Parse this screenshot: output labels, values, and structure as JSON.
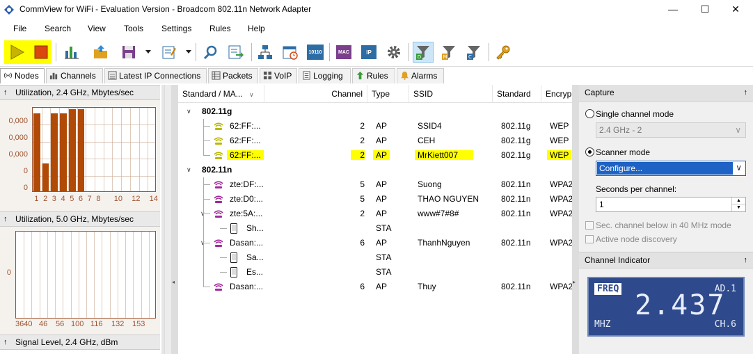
{
  "window": {
    "title": "CommView for WiFi - Evaluation Version - Broadcom 802.11n Network Adapter",
    "minimize": "—",
    "maximize": "☐",
    "close": "✕"
  },
  "menu": [
    "File",
    "Search",
    "View",
    "Tools",
    "Settings",
    "Rules",
    "Help"
  ],
  "toolbar": {
    "icons": [
      "play-icon",
      "stop-icon",
      "bar-chart-icon",
      "open-folder-icon",
      "save-icon",
      "dropdown",
      "report-icon",
      "dropdown",
      "search-icon",
      "export-icon",
      "network-icon",
      "scheduler-icon",
      "packet-generator-icon",
      "mac-icon",
      "ip-icon",
      "gear-icon",
      "filter-data-icon",
      "filter-management-icon",
      "filter-control-icon",
      "key-icon"
    ],
    "labels": {
      "packet_gen": "10110",
      "mac": "MAC",
      "ip": "IP",
      "filter_d": "D",
      "filter_m": "M",
      "filter_c": "C"
    }
  },
  "tabs": [
    "Nodes",
    "Channels",
    "Latest IP Connections",
    "Packets",
    "VoIP",
    "Logging",
    "Rules",
    "Alarms"
  ],
  "left_panel": {
    "sections": [
      "Utilization, 2.4 GHz, Mbytes/sec",
      "Utilization, 5.0 GHz, Mbytes/sec",
      "Signal Level, 2.4 GHz, dBm"
    ],
    "chart24": {
      "y_ticks": [
        "0,000",
        "0,000",
        "0,000",
        "0",
        "0"
      ],
      "x_ticks": [
        "1",
        "2",
        "3",
        "4",
        "5",
        "6",
        "7",
        "8",
        "10",
        "12",
        "14"
      ]
    },
    "chart50": {
      "y_ticks": [
        "0"
      ],
      "x_ticks": [
        "3640",
        "46",
        "56",
        "100",
        "116",
        "132",
        "153"
      ]
    }
  },
  "chart_data": [
    {
      "type": "bar",
      "title": "Utilization, 2.4 GHz, Mbytes/sec",
      "categories": [
        "1",
        "2",
        "3",
        "4",
        "5",
        "6"
      ],
      "values": [
        0.93,
        0.33,
        0.93,
        0.93,
        0.98,
        0.98
      ],
      "ylim": [
        0,
        1
      ],
      "grid": true
    },
    {
      "type": "bar",
      "title": "Utilization, 5.0 GHz, Mbytes/sec",
      "categories": [
        "36",
        "40",
        "46",
        "56",
        "100",
        "116",
        "132",
        "153"
      ],
      "values": [],
      "grid": true
    }
  ],
  "table": {
    "columns": [
      "Standard / MA...",
      "Channel",
      "Type",
      "SSID",
      "Standard",
      "Encryp"
    ],
    "groups": [
      {
        "name": "802.11g",
        "rows": [
          {
            "mac": "62:FF:...",
            "channel": "2",
            "type": "AP",
            "ssid": "SSID4",
            "standard": "802.11g",
            "enc": "WEP",
            "highlight": false
          },
          {
            "mac": "62:FF:...",
            "channel": "2",
            "type": "AP",
            "ssid": "CEH",
            "standard": "802.11g",
            "enc": "WEP",
            "highlight": false
          },
          {
            "mac": "62:FF:...",
            "channel": "2",
            "type": "AP",
            "ssid": "MrKiett007",
            "standard": "802.11g",
            "enc": "WEP",
            "highlight": true
          }
        ]
      },
      {
        "name": "802.11n",
        "rows": [
          {
            "mac": "zte:DF:...",
            "channel": "5",
            "type": "AP",
            "ssid": "Suong",
            "standard": "802.11n",
            "enc": "WPA2"
          },
          {
            "mac": "zte:D0:...",
            "channel": "5",
            "type": "AP",
            "ssid": "THAO NGUYEN",
            "standard": "802.11n",
            "enc": "WPA2"
          },
          {
            "mac": "zte:5A:...",
            "channel": "2",
            "type": "AP",
            "ssid": "www#7#8#",
            "standard": "802.11n",
            "enc": "WPA2"
          },
          {
            "mac": "Sh...",
            "channel": "",
            "type": "STA",
            "ssid": "",
            "standard": "",
            "enc": ""
          },
          {
            "mac": "Dasan:...",
            "channel": "6",
            "type": "AP",
            "ssid": "ThanhNguyen",
            "standard": "802.11n",
            "enc": "WPA2"
          },
          {
            "mac": "Sa...",
            "channel": "",
            "type": "STA",
            "ssid": "",
            "standard": "",
            "enc": ""
          },
          {
            "mac": "Es...",
            "channel": "",
            "type": "STA",
            "ssid": "",
            "standard": "",
            "enc": ""
          },
          {
            "mac": "Dasan:...",
            "channel": "6",
            "type": "AP",
            "ssid": "Thuy",
            "standard": "802.11n",
            "enc": "WPA2"
          }
        ]
      }
    ]
  },
  "capture": {
    "header": "Capture",
    "single_channel": "Single channel mode",
    "single_channel_value": "2.4 GHz - 2",
    "scanner_mode": "Scanner mode",
    "configure": "Configure...",
    "seconds_label": "Seconds per channel:",
    "seconds_value": "1",
    "sec_channel": "Sec. channel below in 40 MHz mode",
    "active_discovery": "Active node discovery",
    "mode": "scanner"
  },
  "channel_indicator": {
    "header": "Channel Indicator",
    "freq_label": "FREQ",
    "freq_value": "2.437",
    "unit": "MHZ",
    "ad": "AD.1",
    "ch": "CH.6"
  }
}
